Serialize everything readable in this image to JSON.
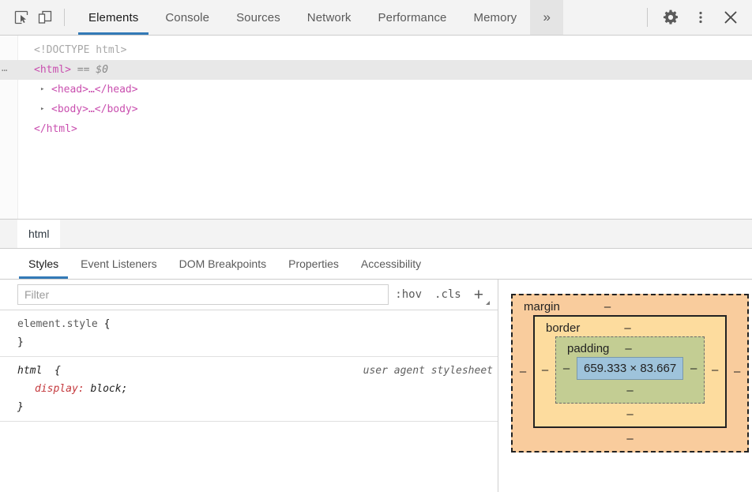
{
  "toolbar": {
    "inspect_icon": "inspect-element-icon",
    "device_icon": "device-toolbar-icon",
    "tabs": [
      {
        "label": "Elements",
        "active": true
      },
      {
        "label": "Console",
        "active": false
      },
      {
        "label": "Sources",
        "active": false
      },
      {
        "label": "Network",
        "active": false
      },
      {
        "label": "Performance",
        "active": false
      },
      {
        "label": "Memory",
        "active": false
      }
    ],
    "overflow_label": "»",
    "settings_icon": "gear-icon",
    "more_icon": "kebab-menu-icon",
    "close_icon": "close-icon",
    "accent_color": "#337ab7"
  },
  "dom_tree": {
    "rows": [
      {
        "id": "doctype",
        "text": "<!DOCTYPE html>"
      },
      {
        "id": "html-open",
        "tag_open": "<html>",
        "suffix": "== $0",
        "badge": "⋯"
      },
      {
        "id": "head",
        "triangle": "▸",
        "text": "<head>…</head>"
      },
      {
        "id": "body",
        "triangle": "▸",
        "text": "<body>…</body>"
      },
      {
        "id": "html-close",
        "text": "</html>"
      }
    ],
    "doctype": "<!DOCTYPE html>",
    "html_open": "<html>",
    "html_suffix": "== $0",
    "badge": "⋯",
    "head_row": "<head>…</head>",
    "body_row": "<body>…</body>",
    "html_close": "</html>",
    "triangle": "▸",
    "tag_color": "#c94faf"
  },
  "breadcrumb": {
    "items": [
      {
        "label": "html",
        "active": true
      }
    ],
    "html_label": "html"
  },
  "sidebar_tabs": [
    {
      "label": "Styles",
      "active": true
    },
    {
      "label": "Event Listeners",
      "active": false
    },
    {
      "label": "DOM Breakpoints",
      "active": false
    },
    {
      "label": "Properties",
      "active": false
    },
    {
      "label": "Accessibility",
      "active": false
    }
  ],
  "styles": {
    "filter": {
      "placeholder": "Filter",
      "value": ""
    },
    "hov_label": ":hov",
    "cls_label": ".cls",
    "new_rule_label": "+",
    "rules": [
      {
        "selector": "element.style",
        "open_brace": "{",
        "close_brace": "}",
        "origin": "",
        "declarations": []
      },
      {
        "selector": "html",
        "open_brace": "{",
        "close_brace": "}",
        "origin": "user agent stylesheet",
        "declarations": [
          {
            "property": "display",
            "value": "block"
          }
        ]
      }
    ],
    "rule0_selector": "element.style",
    "rule0_open": "{",
    "rule0_close": "}",
    "rule1_selector": "html",
    "rule1_open": "{",
    "rule1_close": "}",
    "rule1_origin": "user agent stylesheet",
    "rule1_prop": "display",
    "rule1_val": "block;",
    "prop_color": "#c4393d"
  },
  "box_model": {
    "margin_label": "margin",
    "margin_top": "–",
    "margin_left": "–",
    "margin_right": "–",
    "margin_bottom": "–",
    "border_label": "border",
    "border_top": "–",
    "border_left": "–",
    "border_right": "–",
    "border_bottom": "–",
    "padding_label": "padding",
    "padding_top": "–",
    "padding_left": "–",
    "padding_right": "–",
    "padding_bottom": "–",
    "content_size": "659.333 × 83.667",
    "colors": {
      "margin": "#f9cc9d",
      "border": "#fddc9e",
      "padding": "#c3cd93",
      "content": "#9ec3db"
    }
  },
  "scrollbar": {
    "up_arrow": "scroll-up-arrow",
    "down_arrow": "scroll-down-arrow",
    "thumb": "scroll-thumb"
  }
}
